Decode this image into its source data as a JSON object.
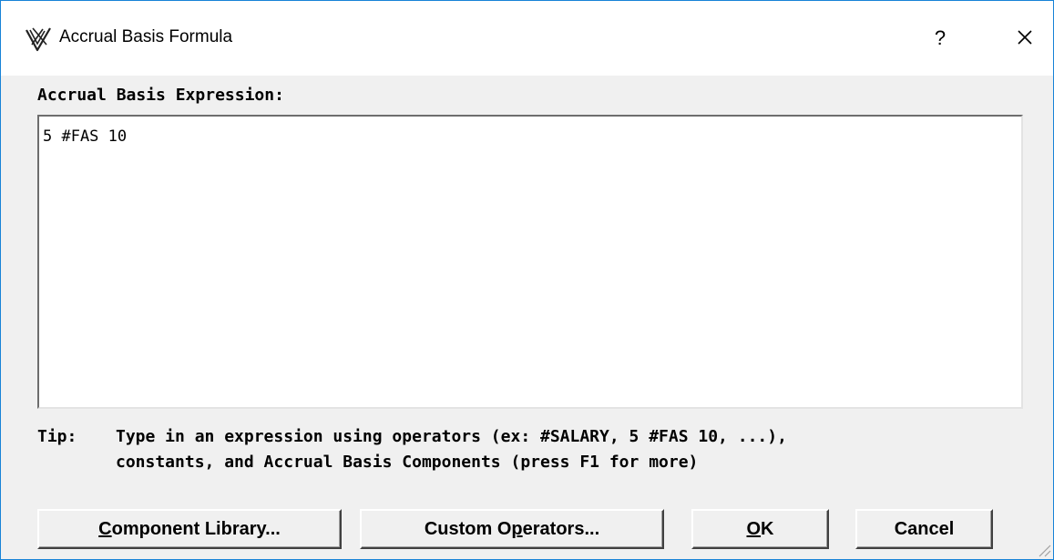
{
  "window": {
    "title": "Accrual Basis Formula",
    "help_label": "?",
    "close_icon": "close-icon",
    "app_icon": "app-logo-icon"
  },
  "expression": {
    "label": "Accrual Basis Expression:",
    "value": "5 #FAS 10"
  },
  "tip": {
    "label": "Tip:",
    "line1": "Type in an expression using operators (ex: #SALARY, 5 #FAS 10, ...),",
    "line2": "constants, and Accrual Basis Components (press F1 for more)"
  },
  "buttons": {
    "component_library": {
      "mnemonic": "C",
      "rest": "omponent Library..."
    },
    "custom_operators": {
      "pre": "Custom O",
      "mnemonic": "p",
      "rest": "erators..."
    },
    "ok": {
      "mnemonic": "O",
      "rest": "K"
    },
    "cancel": {
      "label": "Cancel"
    }
  }
}
